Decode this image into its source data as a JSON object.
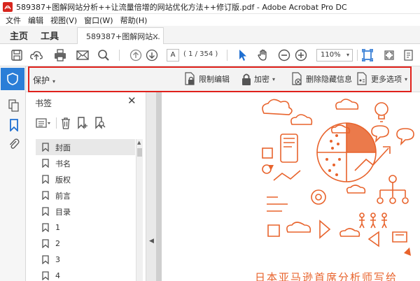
{
  "window": {
    "title": "589387+图解网站分析++让流量倍增的网站优化方法++修订版.pdf - Adobe Acrobat Pro DC"
  },
  "menu": [
    "文件",
    "编辑",
    "视图(V)",
    "窗口(W)",
    "帮助(H)"
  ],
  "tabs": {
    "home": "主页",
    "tools": "工具",
    "document": "589387+图解网站...",
    "close": "×"
  },
  "toolbar": {
    "page_current": "A",
    "page_count": "( 1 / 354 )",
    "zoom": "110%",
    "zoom_caret": "▾",
    "icons": [
      "save-icon",
      "upload-cloud-icon",
      "print-icon",
      "email-icon",
      "search-icon",
      "page-up-icon",
      "page-down-icon",
      "select-cursor-icon",
      "hand-icon",
      "zoom-out-icon",
      "zoom-in-icon",
      "fit-page-icon",
      "fullscreen-icon"
    ]
  },
  "protect_bar": {
    "label": "保护",
    "label_caret": "▾",
    "restrict_edit": "限制编辑",
    "encrypt": "加密",
    "encrypt_caret": "▾",
    "remove_hidden": "删除隐藏信息",
    "more_options": "更多选项",
    "more_caret": "▾"
  },
  "bookmarks": {
    "title": "书签",
    "close": "✕",
    "items": [
      "封面",
      "书名",
      "版权",
      "前言",
      "目录",
      "1",
      "2",
      "3",
      "4"
    ]
  },
  "scrollbar": {
    "up": "▲"
  },
  "splitter": {
    "arrow": "◀"
  },
  "document": {
    "heading": "日本亚马逊首席分析师写给"
  },
  "colors": {
    "accent_blue": "#2b7ed7",
    "highlight_red": "#e0211b",
    "illustration_orange": "#e8632c"
  }
}
